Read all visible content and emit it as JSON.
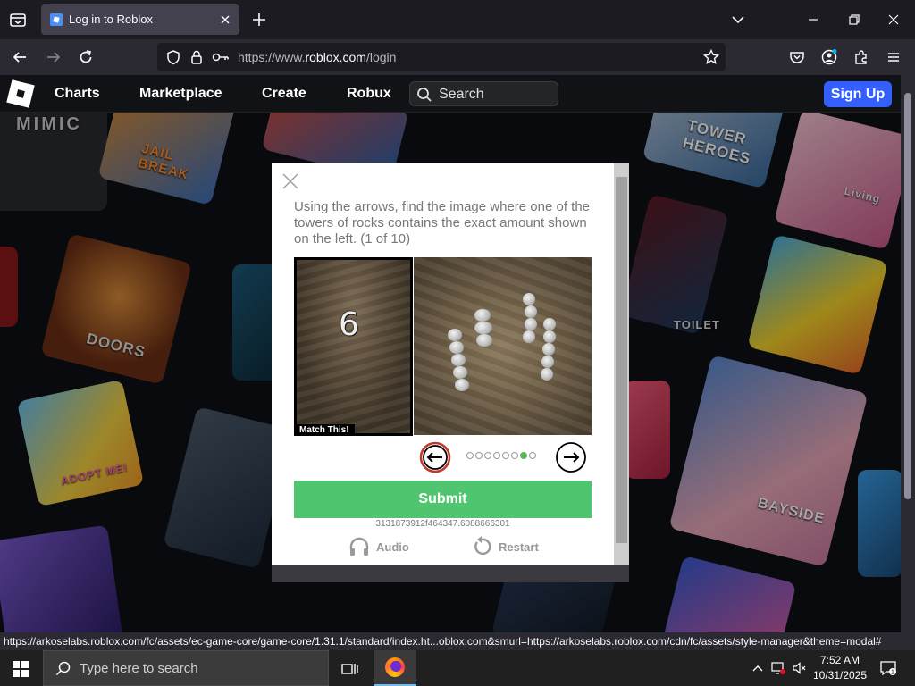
{
  "browser": {
    "tab_title": "Log in to Roblox",
    "url_prefix": "https://www.",
    "url_domain": "roblox.com",
    "url_path": "/login",
    "status_url": "https://arkoselabs.roblox.com/fc/assets/ec-game-core/game-core/1.31.1/standard/index.ht...oblox.com&smurl=https://arkoselabs.roblox.com/cdn/fc/assets/style-manager&theme=modal#"
  },
  "roblox": {
    "nav": [
      "Charts",
      "Marketplace",
      "Create",
      "Robux"
    ],
    "search_placeholder": "Search",
    "signup_label": "Sign Up",
    "tile_labels": [
      "MIMIC",
      "JAIL BREAK",
      "TOWER HEROES",
      "DOORS",
      "ADOPT ME!",
      "TOILET",
      "BAYSIDE",
      "Living"
    ]
  },
  "captcha": {
    "instructions": "Using the arrows, find the image where one of the towers of rocks contains the exact amount shown on the left. (1 of 10)",
    "target_number": "6",
    "match_label": "Match This!",
    "page_count": 8,
    "active_page": 7,
    "submit_label": "Submit",
    "session_id": "3131873912f464347.6088666301",
    "audio_label": "Audio",
    "restart_label": "Restart"
  },
  "taskbar": {
    "search_placeholder": "Type here to search",
    "time": "7:52 AM",
    "date": "10/31/2025"
  },
  "colors": {
    "signup": "#335fff",
    "submit": "#4fc56f",
    "active_dot": "#5cb85c",
    "prev_arrow": "#c0392b"
  },
  "icons": [
    "tab-list-icon",
    "roblox-favicon",
    "close-icon",
    "plus-icon",
    "chevron-down-icon",
    "minimize-icon",
    "maximize-icon",
    "back-arrow-icon",
    "forward-arrow-icon",
    "reload-icon",
    "shield-icon",
    "lock-icon",
    "key-icon",
    "star-icon",
    "pocket-icon",
    "account-icon",
    "extensions-icon",
    "menu-icon",
    "search-icon",
    "headphones-icon",
    "restart-icon",
    "windows-start-icon",
    "task-view-icon",
    "firefox-icon",
    "chevron-up-icon",
    "network-icon",
    "volume-muted-icon",
    "notification-icon"
  ]
}
